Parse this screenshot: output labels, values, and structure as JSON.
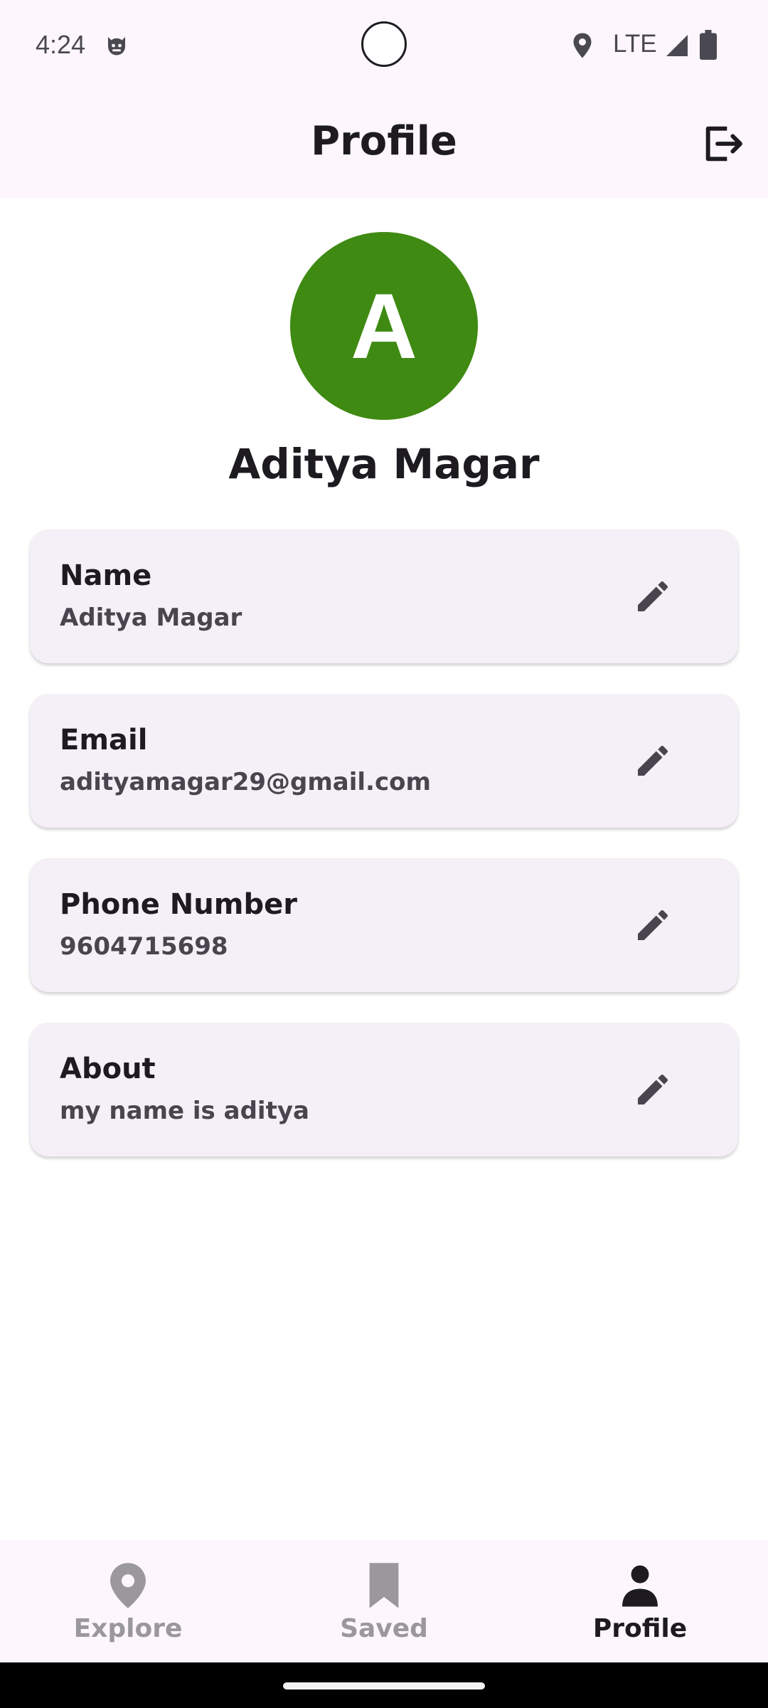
{
  "status_bar": {
    "time": "4:24",
    "network": "LTE",
    "icons": [
      "cat-face-icon",
      "location-icon",
      "signal-icon",
      "battery-icon"
    ]
  },
  "app_bar": {
    "title": "Profile",
    "logout_icon": "logout-icon"
  },
  "profile": {
    "avatar_initial": "A",
    "avatar_color": "#3f8a13",
    "display_name": "Aditya Magar"
  },
  "fields": [
    {
      "label": "Name",
      "value": "Aditya Magar"
    },
    {
      "label": "Email",
      "value": "adityamagar29@gmail.com"
    },
    {
      "label": "Phone Number",
      "value": "9604715698"
    },
    {
      "label": "About",
      "value": "my name is aditya"
    }
  ],
  "bottom_nav": {
    "items": [
      {
        "label": "Explore",
        "icon": "map-pin-icon",
        "active": false
      },
      {
        "label": "Saved",
        "icon": "bookmark-icon",
        "active": false
      },
      {
        "label": "Profile",
        "icon": "person-icon",
        "active": true
      }
    ]
  },
  "colors": {
    "surface": "#fdf6fd",
    "card": "#f5eff7",
    "active_nav": "#1d1b20",
    "inactive_nav": "#9a979d"
  }
}
